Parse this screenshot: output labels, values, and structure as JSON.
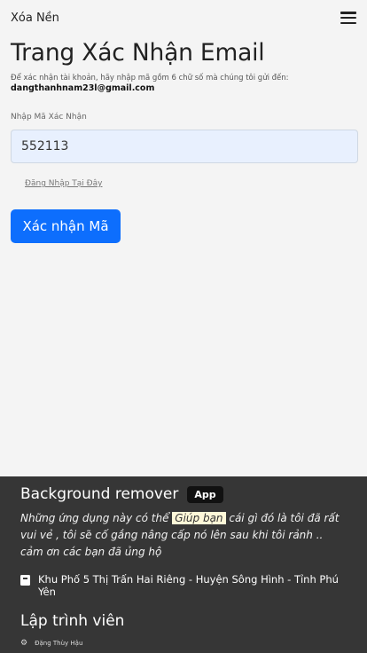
{
  "navbar": {
    "brand": "Xóa Nền",
    "menu_icon": "hamburger-menu-icon"
  },
  "main": {
    "title": "Trang Xác Nhận Email",
    "instructions": "Để xác nhận tài khoản, hãy nhập mã gồm 6 chữ số mà chúng tôi gửi đến:",
    "email": "dangthanhnam23l@gmail.com",
    "code_label": "Nhập Mã Xác Nhận",
    "code_value": "552113",
    "login_link": "Đăng Nhập Tại Đây",
    "submit_label": "Xác nhận Mã"
  },
  "footer": {
    "title": "Background remover",
    "badge": "App",
    "desc_before": "Những ứng dụng này có thể",
    "desc_highlight": "Giúp bạn",
    "desc_after": "cái gì đó là tôi đã rất vui vẻ , tôi sẽ cố gắng nâng cấp nó lên sau khi tôi rảnh .. cảm ơn các bạn đã ủng hộ",
    "address_icon": "address-card-icon",
    "address": "Khu Phố 5 Thị Trấn Hai Riêng - Huyện Sông Hình - Tỉnh Phú Yên",
    "dev_title": "Lập trình viên",
    "dev_icon": "gear-icon",
    "dev_name": "Đặng Thùy Hậu"
  },
  "colors": {
    "accent": "#0d6efd",
    "input_bg": "#e8f0fe",
    "footer_bg": "#363636",
    "page_bg": "#f4f4f4"
  }
}
